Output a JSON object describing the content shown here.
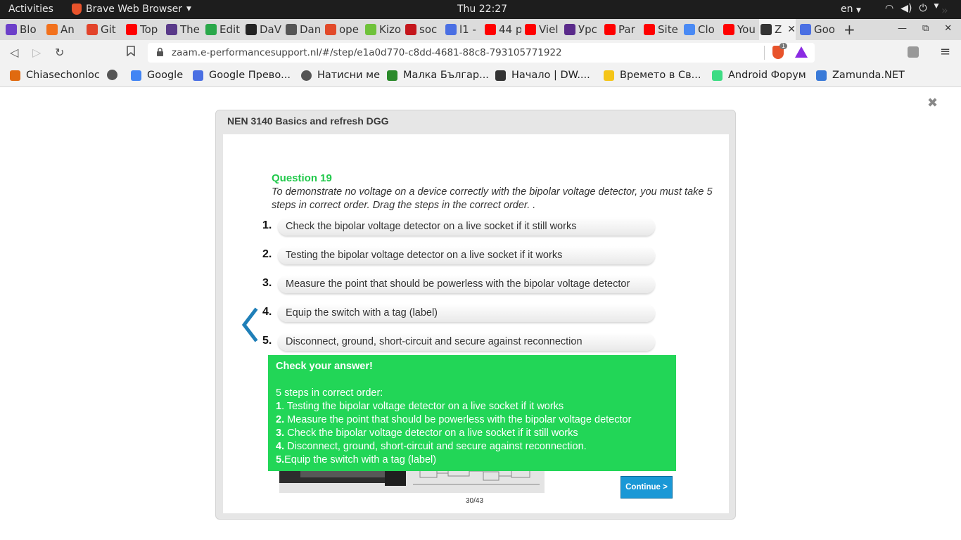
{
  "topbar": {
    "activities": "Activities",
    "app_name": "Brave Web Browser",
    "clock": "Thu 22:27",
    "language": "en"
  },
  "tabs": [
    {
      "label": "Blo",
      "color": "#6c3fc9"
    },
    {
      "label": "An",
      "color": "#f2711c"
    },
    {
      "label": "Git",
      "color": "#e2432a"
    },
    {
      "label": "Top",
      "color": "#ff0000"
    },
    {
      "label": "The",
      "color": "#5a3a8a"
    },
    {
      "label": "Edit",
      "color": "#2aa84a"
    },
    {
      "label": "DaV",
      "color": "#222222"
    },
    {
      "label": "Dan",
      "color": "#555555"
    },
    {
      "label": "ope",
      "color": "#e24a2a"
    },
    {
      "label": "Kizo",
      "color": "#6fc23a"
    },
    {
      "label": "soc",
      "color": "#c4161c"
    },
    {
      "label": "l1 -",
      "color": "#4a6fe3"
    },
    {
      "label": "44 p",
      "color": "#ff0000"
    },
    {
      "label": "Viel",
      "color": "#ff0000"
    },
    {
      "label": "Урс",
      "color": "#5a2a8a"
    },
    {
      "label": "Par",
      "color": "#ff0000"
    },
    {
      "label": "Site",
      "color": "#ff0000"
    },
    {
      "label": "Clo",
      "color": "#4a8af4"
    },
    {
      "label": "You",
      "color": "#ff0000"
    },
    {
      "label": "Z",
      "color": "#333333",
      "active": true
    },
    {
      "label": "Goo",
      "color": "#4a6fe3"
    }
  ],
  "toolbar": {
    "url": "zaam.e-performancesupport.nl/#/step/e1a0d770-c8dd-4681-88c8-793105771922",
    "shield_count": "1"
  },
  "bookmarks": [
    {
      "label": "Chiasechonloc",
      "color": "#e06a10"
    },
    {
      "label": "",
      "color": "#555555"
    },
    {
      "label": "Google",
      "color": "#4285f4"
    },
    {
      "label": "Google Прево...",
      "color": "#4a6fe3"
    },
    {
      "label": "Натисни ме",
      "color": "#555555"
    },
    {
      "label": "Малка Българ...",
      "color": "#2a8a2a"
    },
    {
      "label": "Начало | DW....",
      "color": "#333333"
    },
    {
      "label": "Времето в Св...",
      "color": "#f5c518"
    },
    {
      "label": "Android Форум",
      "color": "#3ddc84"
    },
    {
      "label": "Zamunda.NET",
      "color": "#3a7ad8"
    }
  ],
  "modal": {
    "title": "NEN 3140 Basics and refresh DGG",
    "question_label": "Question 19",
    "question_text": "To demonstrate no voltage on a device correctly with the bipolar voltage detector, you must take 5 steps in correct order. Drag the steps in the correct order. .",
    "steps": [
      {
        "num": "1.",
        "text": "Check the bipolar voltage detector on a live socket if it still works"
      },
      {
        "num": "2.",
        "text": "Testing the bipolar voltage detector on a live socket if it works"
      },
      {
        "num": "3.",
        "text": "Measure the point that should be powerless with the bipolar voltage detector"
      },
      {
        "num": "4.",
        "text": "Equip the switch with a tag (label)"
      },
      {
        "num": "5.",
        "text": "Disconnect, ground, short-circuit and secure against reconnection"
      }
    ],
    "feedback": {
      "title": "Check your answer!",
      "intro": "5 steps in correct order:",
      "lines": [
        {
          "num": "1",
          "text": ". Testing the bipolar voltage detector on a live socket if it works"
        },
        {
          "num": "2.",
          "text": " Measure the point that should be powerless with the bipolar voltage detector"
        },
        {
          "num": "3.",
          "text": " Check the bipolar voltage detector on a live socket if it still works"
        },
        {
          "num": "4.",
          "text": " Disconnect, ground, short-circuit and secure against reconnection."
        },
        {
          "num": "5.",
          "text": "Equip the switch with a tag (label)"
        }
      ]
    },
    "continue_label": "Continue >",
    "progress": "30/43"
  },
  "colors": {
    "accent_green": "#22c94c",
    "feedback_green": "#22d657",
    "continue_blue": "#1a98d6"
  }
}
